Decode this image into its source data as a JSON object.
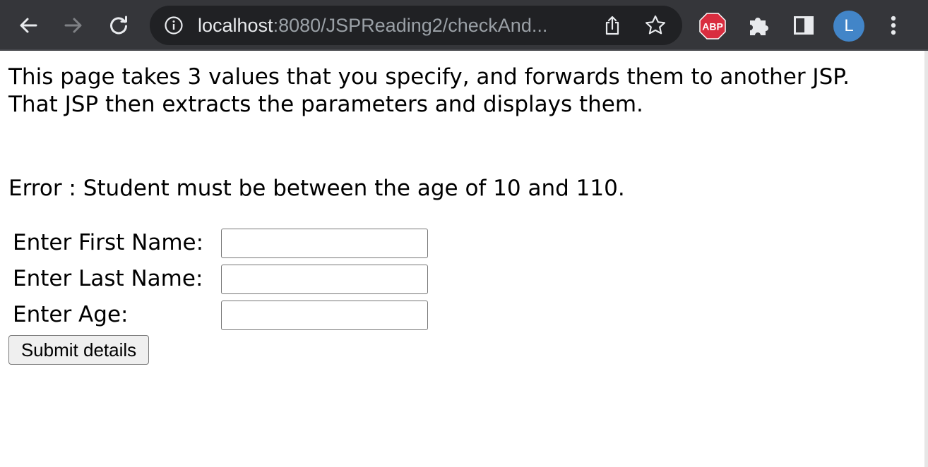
{
  "browser": {
    "url_host": "localhost",
    "url_rest": ":8080/JSPReading2/checkAnd...",
    "extension_badge": "ABP",
    "profile_initial": "L",
    "icons": [
      "back-arrow-icon",
      "forward-arrow-icon",
      "reload-icon",
      "info-icon",
      "share-icon",
      "star-icon",
      "adblock-icon",
      "puzzle-icon",
      "side-panel-icon",
      "kebab-menu-icon"
    ]
  },
  "page": {
    "intro": "This page takes 3 values that you specify, and forwards them to another JSP. That JSP then extracts the parameters and displays them.",
    "error": "Error : Student must be between the age of 10 and 110.",
    "fields": [
      {
        "label": "Enter First Name:",
        "value": ""
      },
      {
        "label": "Enter Last Name:",
        "value": ""
      },
      {
        "label": "Enter Age:",
        "value": ""
      }
    ],
    "submit_label": "Submit details"
  },
  "colors": {
    "toolbar_bg": "#35363a",
    "omnibox_bg": "#202124",
    "abp_red": "#d92d3f",
    "avatar_blue": "#4285c8"
  }
}
